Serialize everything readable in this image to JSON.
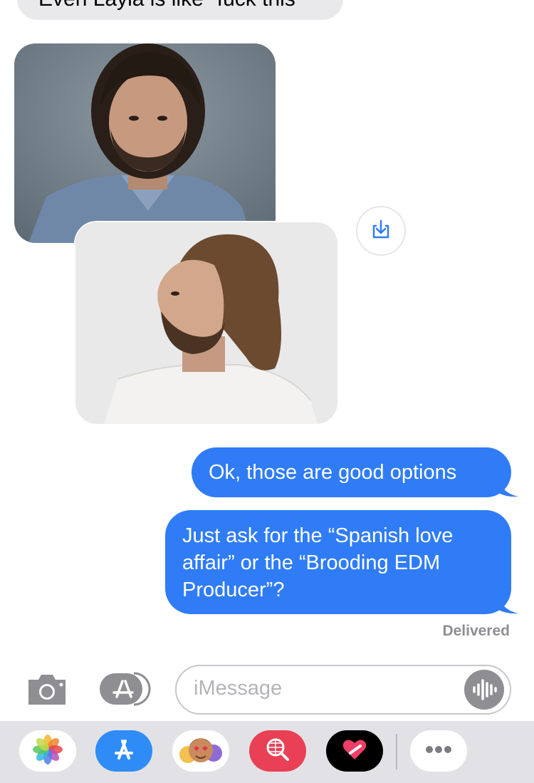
{
  "conversation": {
    "received_message": "Even Layla is like \"fuck this\"",
    "sent_messages": [
      "Ok, those are good options",
      "Just ask for the “Spanish love affair” or the “Brooding EDM Producer”?"
    ],
    "status": "Delivered"
  },
  "input": {
    "placeholder": "iMessage"
  },
  "app_drawer": {
    "apps": [
      "photos-app",
      "app-store-app",
      "memoji-app",
      "web-images-search-app",
      "digital-touch-app",
      "more-apps"
    ]
  },
  "colors": {
    "sent_bubble": "#2f7cf6",
    "received_bubble": "#e9e9eb",
    "status_text": "#8e8e93"
  }
}
